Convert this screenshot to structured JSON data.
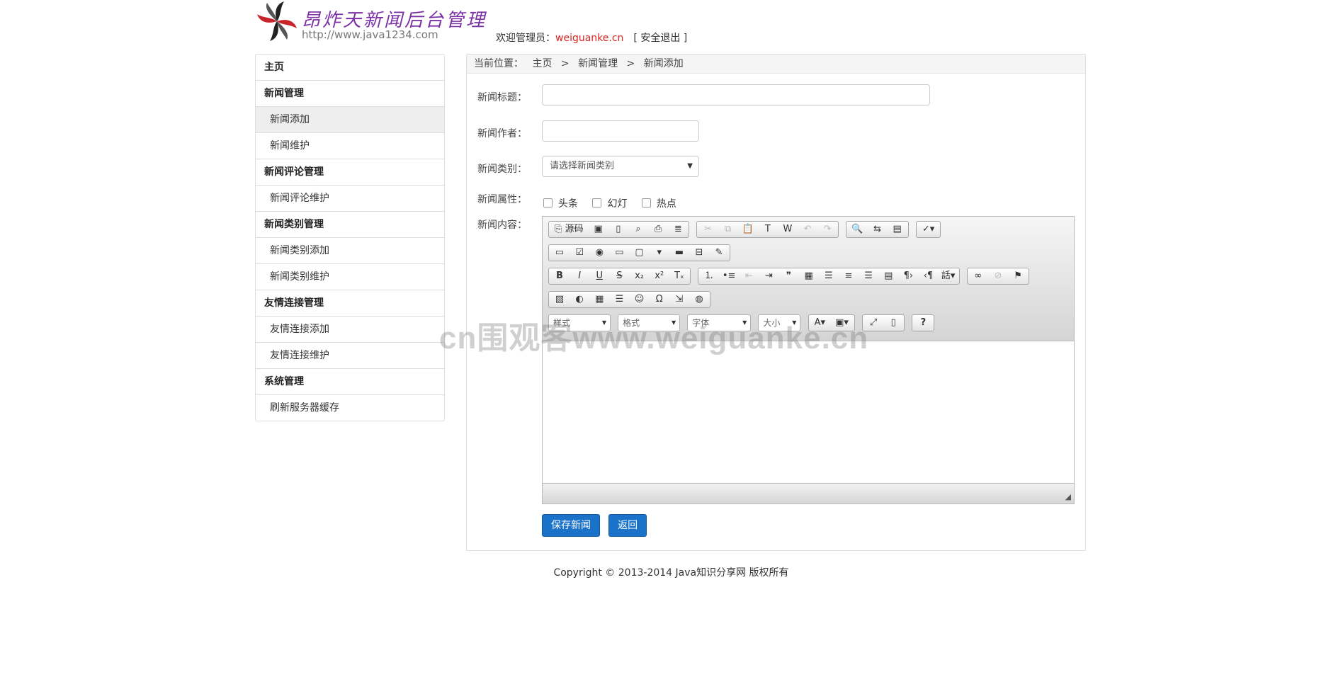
{
  "header": {
    "brand": "昂炸天新闻后台管理",
    "url": "http://www.java1234.com",
    "welcome_label": "欢迎管理员：",
    "username": "weiguanke.cn",
    "logout": "[ 安全退出 ]"
  },
  "sidebar": {
    "items": [
      {
        "label": "主页"
      },
      {
        "label": "新闻管理"
      },
      {
        "label": "新闻添加"
      },
      {
        "label": "新闻维护"
      },
      {
        "label": "新闻评论管理"
      },
      {
        "label": "新闻评论维护"
      },
      {
        "label": "新闻类别管理"
      },
      {
        "label": "新闻类别添加"
      },
      {
        "label": "新闻类别维护"
      },
      {
        "label": "友情连接管理"
      },
      {
        "label": "友情连接添加"
      },
      {
        "label": "友情连接维护"
      },
      {
        "label": "系统管理"
      },
      {
        "label": "刷新服务器缓存"
      }
    ]
  },
  "breadcrumb": {
    "prefix": "当前位置：",
    "home": "主页",
    "sep": ">",
    "section": "新闻管理",
    "page": "新闻添加"
  },
  "form": {
    "title_label": "新闻标题：",
    "title_value": "",
    "author_label": "新闻作者：",
    "author_value": "",
    "type_label": "新闻类别：",
    "type_selected": "请选择新闻类别",
    "attr_label": "新闻属性：",
    "attr_options": [
      "头条",
      "幻灯",
      "热点"
    ],
    "content_label": "新闻内容："
  },
  "editor": {
    "source_label": "源码",
    "styles_combo": "样式",
    "format_combo": "格式",
    "font_combo": "字体",
    "size_combo": "大小",
    "help_label": "?"
  },
  "actions": {
    "save": "保存新闻",
    "back": "返回"
  },
  "footer": {
    "copyright": "Copyright © 2013-2014 Java知识分享网 版权所有"
  },
  "watermark": "cn围观客www.weiguanke.cn",
  "colors": {
    "primary_button": "#1a73c9",
    "username": "#dd2222",
    "brand": "#7b2fa6"
  }
}
